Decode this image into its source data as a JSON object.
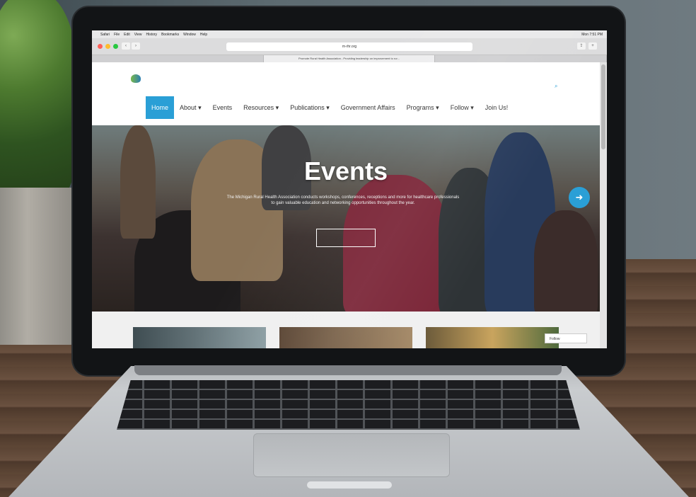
{
  "browser": {
    "system_menu": [
      "Safari",
      "File",
      "Edit",
      "View",
      "History",
      "Bookmarks",
      "Window",
      "Help"
    ],
    "clock": "Mon 7:51 PM",
    "url": "m-rhr.org",
    "tabs": [
      "",
      "Promote Rural Health Association - Providing leadership on improvement to rur...",
      ""
    ]
  },
  "site": {
    "nav": [
      {
        "label": "Home",
        "active": true
      },
      {
        "label": "About",
        "dropdown": true
      },
      {
        "label": "Events"
      },
      {
        "label": "Resources",
        "dropdown": true
      },
      {
        "label": "Publications",
        "dropdown": true
      },
      {
        "label": "Government Affairs"
      },
      {
        "label": "Programs",
        "dropdown": true
      },
      {
        "label": "Follow",
        "dropdown": true
      },
      {
        "label": "Join Us!"
      }
    ],
    "hero": {
      "title": "Events",
      "text": "The Michigan Rural Health Association conducts workshops, conferences, receptions and more for healthcare professionals to gain valuable education and networking opportunities throughout the year."
    },
    "follow_widget": "Follow"
  },
  "colors": {
    "accent": "#2a9fd6"
  }
}
